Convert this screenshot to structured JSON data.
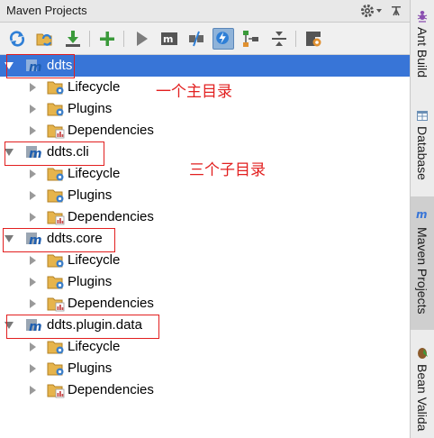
{
  "header": {
    "title": "Maven Projects"
  },
  "toolbar": {
    "buttons": [
      {
        "name": "reimport-icon"
      },
      {
        "name": "generate-sources-icon"
      },
      {
        "name": "download-icon"
      },
      {
        "name": "add-icon"
      },
      {
        "name": "run-icon"
      },
      {
        "name": "maven-goal-icon"
      },
      {
        "name": "toggle-offline-icon"
      },
      {
        "name": "skip-tests-icon"
      },
      {
        "name": "show-dependencies-icon"
      },
      {
        "name": "collapse-all-icon"
      },
      {
        "name": "settings-icon"
      }
    ],
    "active_button": "skip-tests-icon"
  },
  "tree": {
    "projects": [
      {
        "label": "ddts",
        "selected": true,
        "children": [
          "Lifecycle",
          "Plugins",
          "Dependencies"
        ]
      },
      {
        "label": "ddts.cli",
        "selected": false,
        "children": [
          "Lifecycle",
          "Plugins",
          "Dependencies"
        ]
      },
      {
        "label": "ddts.core",
        "selected": false,
        "children": [
          "Lifecycle",
          "Plugins",
          "Dependencies"
        ]
      },
      {
        "label": "ddts.plugin.data",
        "selected": false,
        "children": [
          "Lifecycle",
          "Plugins",
          "Dependencies"
        ]
      }
    ]
  },
  "annotations": {
    "main_note": "一个主目录",
    "sub_note": "三个子目录",
    "color": "#e21f1f"
  },
  "side_tabs": [
    {
      "label": "Ant Build",
      "icon": "ant-icon"
    },
    {
      "label": "Database",
      "icon": "database-icon"
    },
    {
      "label": "Maven Projects",
      "icon": "maven-icon",
      "active": true
    },
    {
      "label": "Bean Valida",
      "icon": "bean-icon"
    }
  ],
  "colors": {
    "selection": "#3875d7",
    "accent_blue": "#3875d7"
  }
}
